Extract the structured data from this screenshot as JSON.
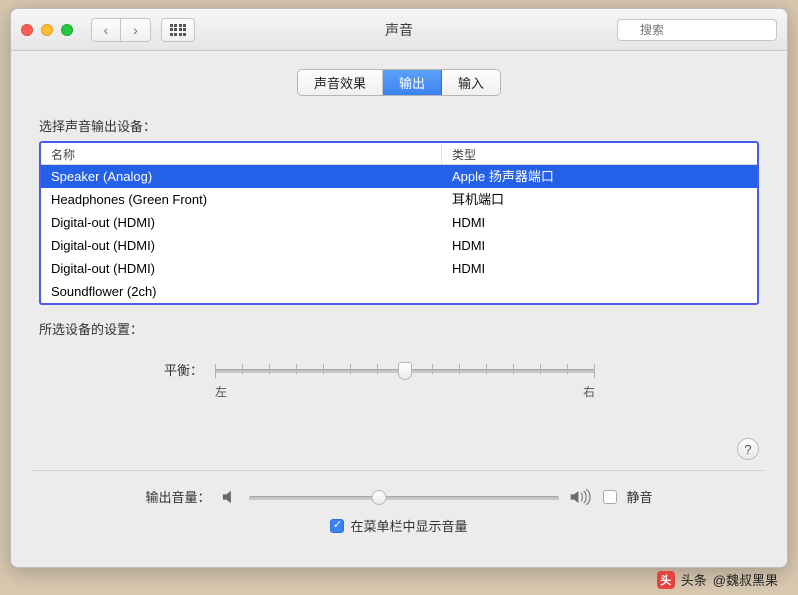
{
  "window": {
    "title": "声音"
  },
  "toolbar": {
    "search_placeholder": "搜索"
  },
  "tabs": {
    "sound_effects": "声音效果",
    "output": "输出",
    "input": "输入"
  },
  "section": {
    "select_device": "选择声音输出设备：",
    "columns": {
      "name": "名称",
      "type": "类型"
    },
    "devices": [
      {
        "name": "Speaker (Analog)",
        "type": "Apple 扬声器端口",
        "selected": true
      },
      {
        "name": "Headphones (Green Front)",
        "type": "耳机端口"
      },
      {
        "name": "Digital-out (HDMI)",
        "type": "HDMI"
      },
      {
        "name": "Digital-out (HDMI)",
        "type": "HDMI"
      },
      {
        "name": "Digital-out (HDMI)",
        "type": "HDMI"
      },
      {
        "name": "Soundflower (2ch)",
        "type": ""
      }
    ]
  },
  "settings": {
    "label": "所选设备的设置：",
    "balance": {
      "label": "平衡：",
      "left": "左",
      "right": "右",
      "value": 0.5
    }
  },
  "help": "?",
  "volume": {
    "label": "输出音量：",
    "mute": "静音",
    "value": 0.42,
    "menubar_checked": true,
    "menubar_label": "在菜单栏中显示音量"
  },
  "attribution": {
    "prefix": "头条",
    "author": "@魏叔黑果"
  }
}
